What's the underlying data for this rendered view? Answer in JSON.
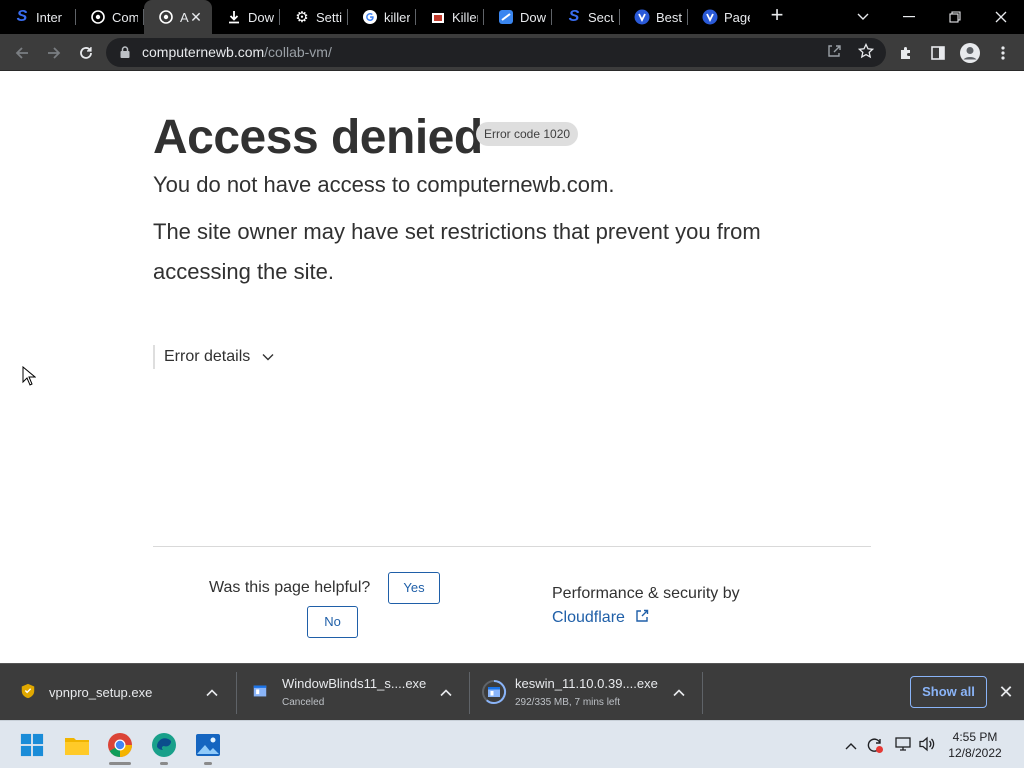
{
  "tabs": [
    {
      "title": "Intern",
      "favicon": "s-logo-icon",
      "color": "#3a6df0"
    },
    {
      "title": "Comp",
      "favicon": "cloudflare-bot-icon",
      "color": "#ffffff"
    },
    {
      "title": "A",
      "favicon": "cloudflare-bot-icon",
      "color": "#ffffff",
      "active": true
    },
    {
      "title": "Down",
      "favicon": "download-icon",
      "color": "#ffffff"
    },
    {
      "title": "Settin",
      "favicon": "gear-icon",
      "color": "#ffffff"
    },
    {
      "title": "killer",
      "favicon": "google-icon",
      "color": "#4285f4"
    },
    {
      "title": "Killer",
      "favicon": "store-icon",
      "color": "#ffffff"
    },
    {
      "title": "Down",
      "favicon": "softpedia-icon",
      "color": "#3a86f0"
    },
    {
      "title": "Secur",
      "favicon": "s-logo-icon",
      "color": "#3a6df0"
    },
    {
      "title": "Best",
      "favicon": "v-logo-icon",
      "color": "#2a5ad8"
    },
    {
      "title": "Page",
      "favicon": "v-logo-icon",
      "color": "#2a5ad8"
    }
  ],
  "address": {
    "host": "computernewb.com",
    "path": "/collab-vm/"
  },
  "page": {
    "heading": "Access denied",
    "error_code": "Error code 1020",
    "line1": "You do not have access to computernewb.com.",
    "line2": "The site owner may have set restrictions that prevent you from accessing the site.",
    "details_label": "Error details",
    "helpful_question": "Was this page helpful?",
    "yes_label": "Yes",
    "no_label": "No",
    "perf_label": "Performance & security by",
    "cloudflare_link": "Cloudflare"
  },
  "downloads": [
    {
      "name": "vpnpro_setup.exe",
      "status": ""
    },
    {
      "name": "WindowBlinds11_s....exe",
      "status": "Canceled"
    },
    {
      "name": "keswin_11.10.0.39....exe",
      "status": "292/335 MB, 7 mins left"
    }
  ],
  "download_bar": {
    "show_all_label": "Show all"
  },
  "taskbar": {
    "time": "4:55 PM",
    "date": "12/8/2022"
  },
  "colors": {
    "link": "#1f5fa8",
    "heading": "#313131",
    "chrome_dark": "#3c3c3c"
  }
}
